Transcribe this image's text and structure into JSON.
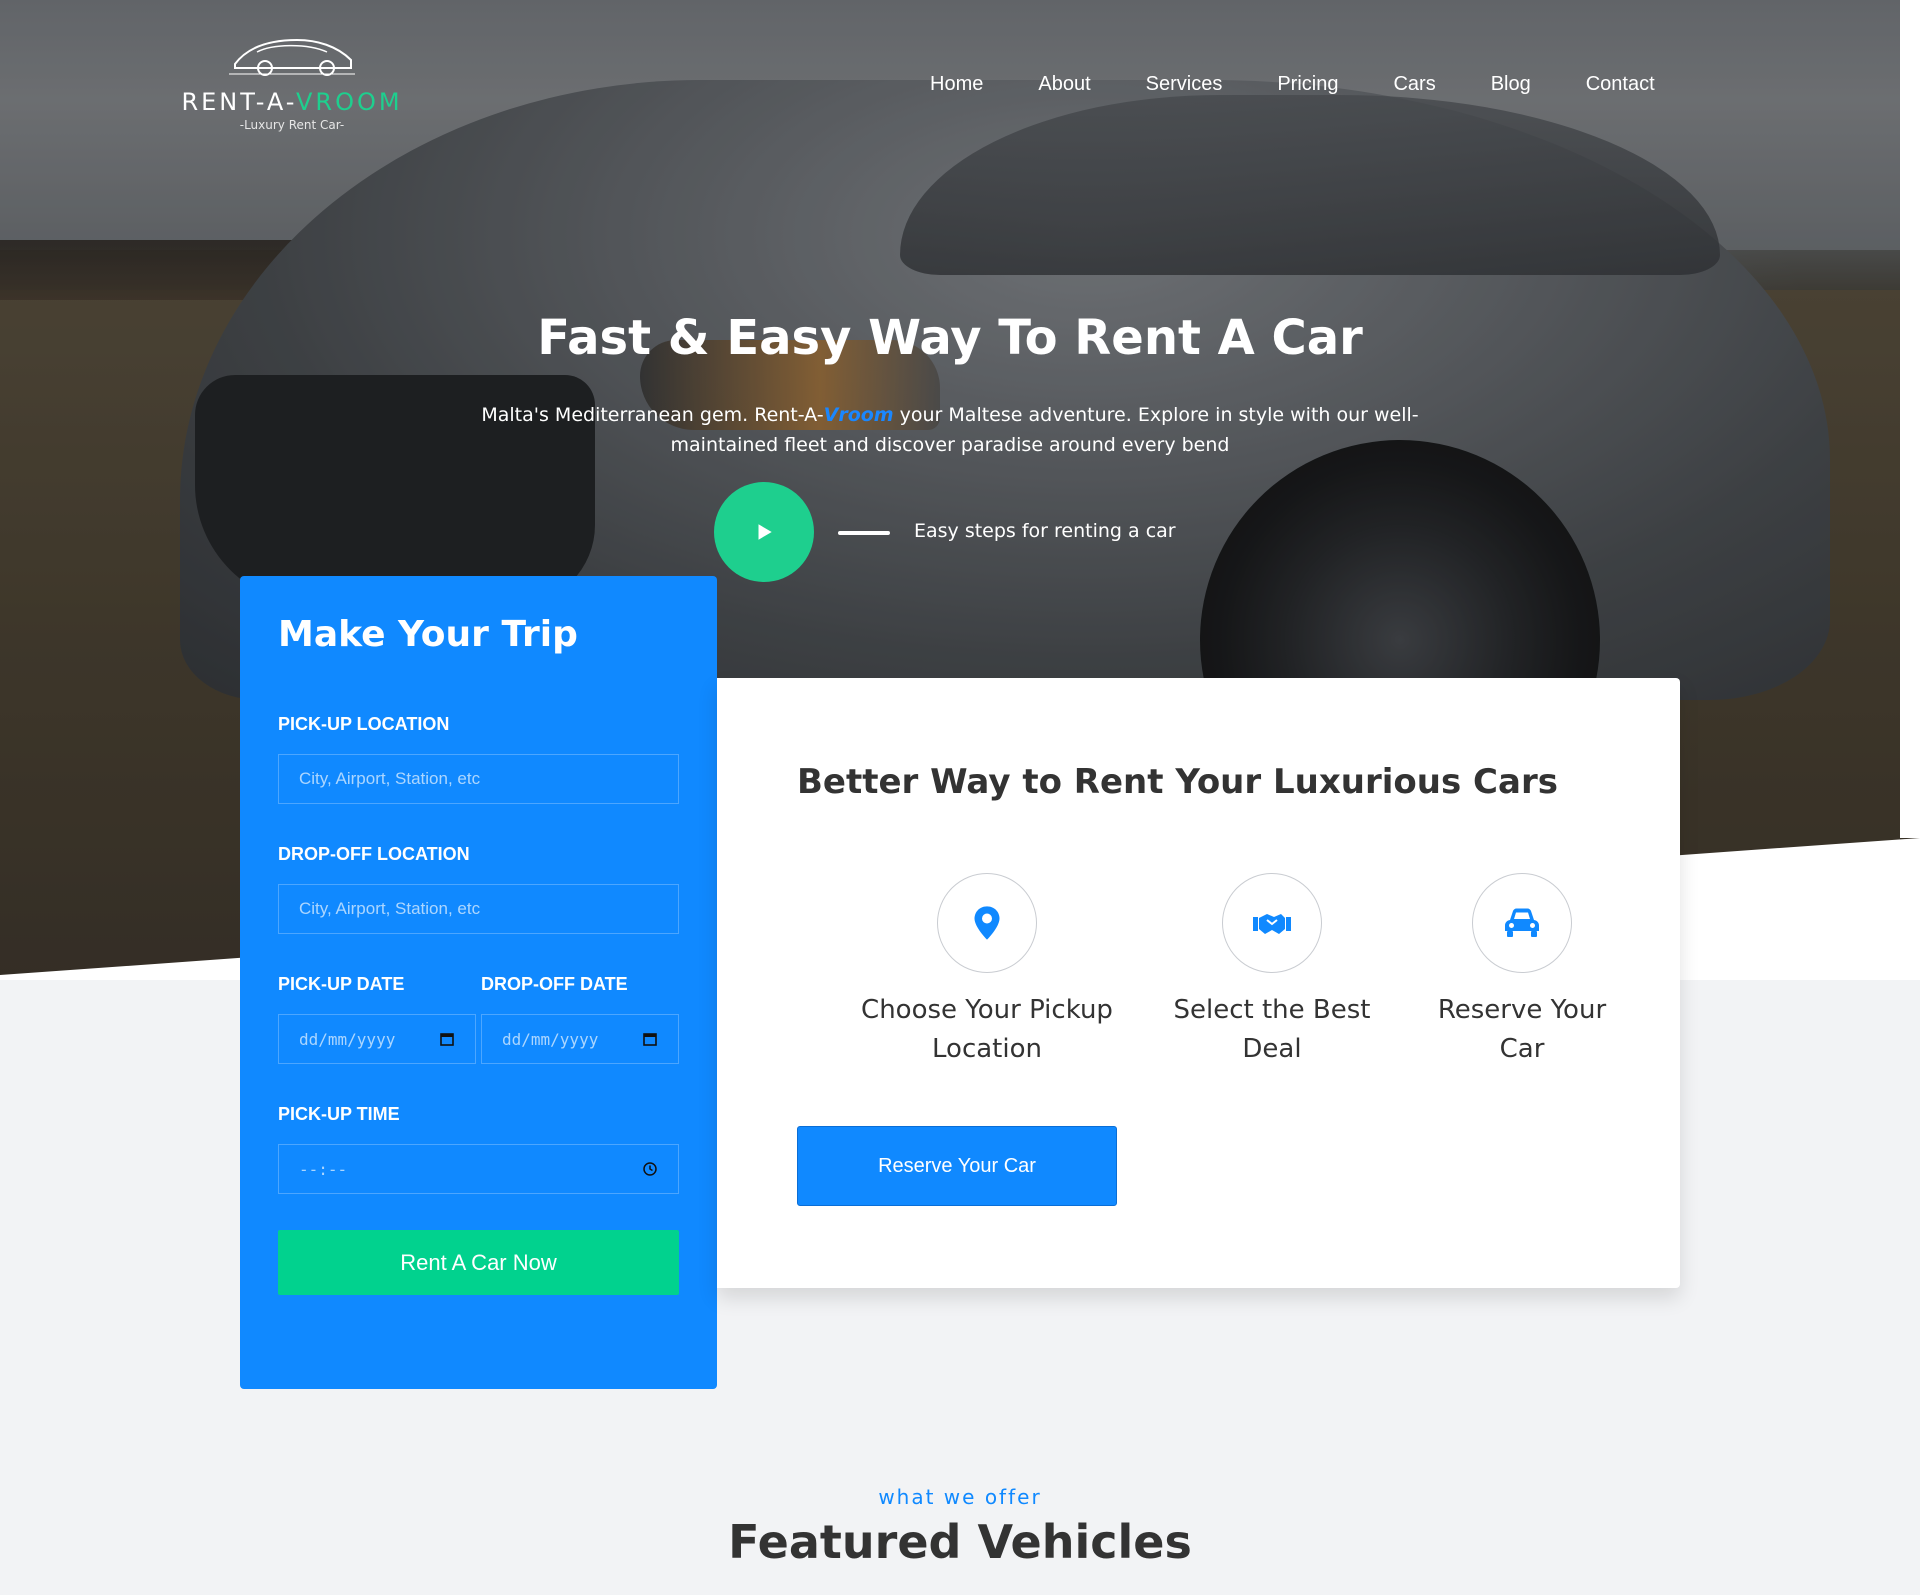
{
  "brand": {
    "logo_prefix": "RENT-A-",
    "logo_accent": "VROOM",
    "tagline": "-Luxury Rent Car-",
    "accent_color": "#1ecf8e",
    "primary_color": "#1089ff"
  },
  "nav": {
    "items": [
      "Home",
      "About",
      "Services",
      "Pricing",
      "Cars",
      "Blog",
      "Contact"
    ]
  },
  "hero": {
    "title": "Fast & Easy Way To Rent A Car",
    "subtitle_part1": "Malta's Mediterranean gem. Rent-A-",
    "subtitle_brand": "Vroom",
    "subtitle_part2": " your Maltese adventure. Explore in style with our well-maintained fleet and discover paradise around every bend",
    "play_label": "Easy steps for renting a car",
    "play_icon": "play-icon"
  },
  "trip_form": {
    "title": "Make Your Trip",
    "pickup_location_label": "PICK-UP LOCATION",
    "pickup_location_placeholder": "City, Airport, Station, etc",
    "dropoff_location_label": "DROP-OFF LOCATION",
    "dropoff_location_placeholder": "City, Airport, Station, etc",
    "pickup_date_label": "PICK-UP DATE",
    "pickup_date_placeholder": "dd/mm/yyyy",
    "dropoff_date_label": "DROP-OFF DATE",
    "dropoff_date_placeholder": "dd/mm/yyyy",
    "pickup_time_label": "PICK-UP TIME",
    "pickup_time_placeholder": "--:--",
    "submit_label": "Rent A Car Now"
  },
  "services_card": {
    "title": "Better Way to Rent Your Luxurious Cars",
    "services": [
      {
        "icon": "map-pin-icon",
        "line1": "Choose Your Pickup",
        "line2": "Location"
      },
      {
        "icon": "handshake-icon",
        "line1": "Select the Best",
        "line2": "Deal"
      },
      {
        "icon": "car-icon",
        "line1": "Reserve Your",
        "line2": "Car"
      }
    ],
    "button_label": "Reserve Your Car"
  },
  "featured": {
    "tag": "what we offer",
    "title": "Featured Vehicles"
  }
}
